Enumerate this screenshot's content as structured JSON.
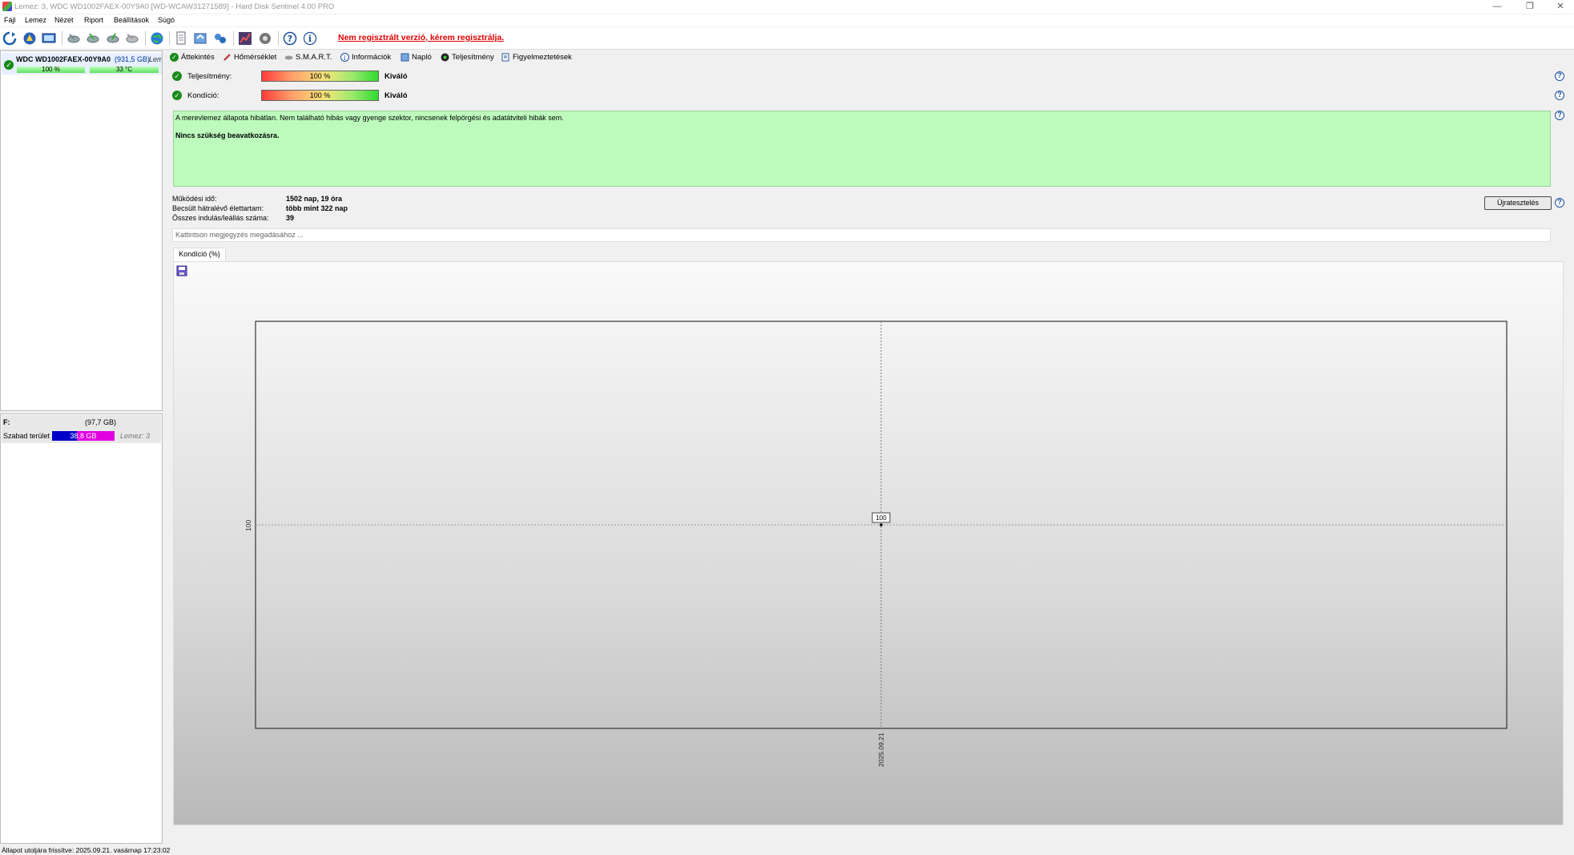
{
  "window": {
    "title": "Lemez: 3, WDC WD1002FAEX-00Y9A0 [WD-WCAW31271589]  -  Hard Disk Sentinel 4.00 PRO",
    "minimize": "—",
    "restore": "❐",
    "close": "✕"
  },
  "menu": [
    "Fájl",
    "Lemez",
    "Nézet",
    "Riport",
    "Beállítások",
    "Súgó"
  ],
  "toolbar": {
    "unregistered_text": "Nem regisztrált verzió, kérem regisztrálja."
  },
  "drive": {
    "name": "WDC WD1002FAEX-00Y9A0",
    "size": "(931,5 GB)",
    "disk_label": "Lem",
    "health": "100 %",
    "temperature": "33 °C"
  },
  "volume": {
    "letter": "F:",
    "size": "(97,7 GB)",
    "free_label": "Szabad terület",
    "free_value": "38,8 GB",
    "free_fraction": 0.4,
    "disk_ref": "Lemez: 3"
  },
  "tabs": [
    "Áttekintés",
    "Hőmérséklet",
    "S.M.A.R.T.",
    "Információk",
    "Napló",
    "Teljesítmény",
    "Figyelmeztetések"
  ],
  "overview": {
    "performance_label": "Teljesítmény:",
    "performance_value": "100 %",
    "performance_rating": "Kiváló",
    "condition_label": "Kondíció:",
    "condition_value": "100 %",
    "condition_rating": "Kiváló",
    "status_message": "A merevlemez állapota hibátlan. Nem található hibás vagy gyenge szektor, nincsenek felpörgési és adatátviteli hibák sem.",
    "status_action": "Nincs szükség beavatkozásra.",
    "uptime_label": "Működési idő:",
    "uptime_value": "1502 nap, 19 óra",
    "remaining_label": "Becsült hátralévő élettartam:",
    "remaining_value": "több mint 322 nap",
    "starts_label": "Összes indulás/leállás száma:",
    "starts_value": "39",
    "retest_button": "Újratesztelés",
    "note_placeholder": "Kattintson megjegyzés megadásához ...",
    "chart_tab": "Kondíció  (%)"
  },
  "chart_data": {
    "type": "line",
    "x": [
      "2025.09.21"
    ],
    "series": [
      {
        "values": [
          100
        ]
      }
    ],
    "point_labels": [
      "100"
    ],
    "y_tick_labels": [
      "100"
    ],
    "grid": true
  },
  "statusbar": {
    "text": "Állapot utoljára frissítve: 2025.09.21. vasárnap 17:23:02"
  },
  "colors": {
    "status_bg": "#bdfbbd",
    "ok_green": "#1a8a1a",
    "unregistered_red": "#e00000",
    "free_space_blue": "#0000c8",
    "used_space_magenta": "#e000e0"
  }
}
